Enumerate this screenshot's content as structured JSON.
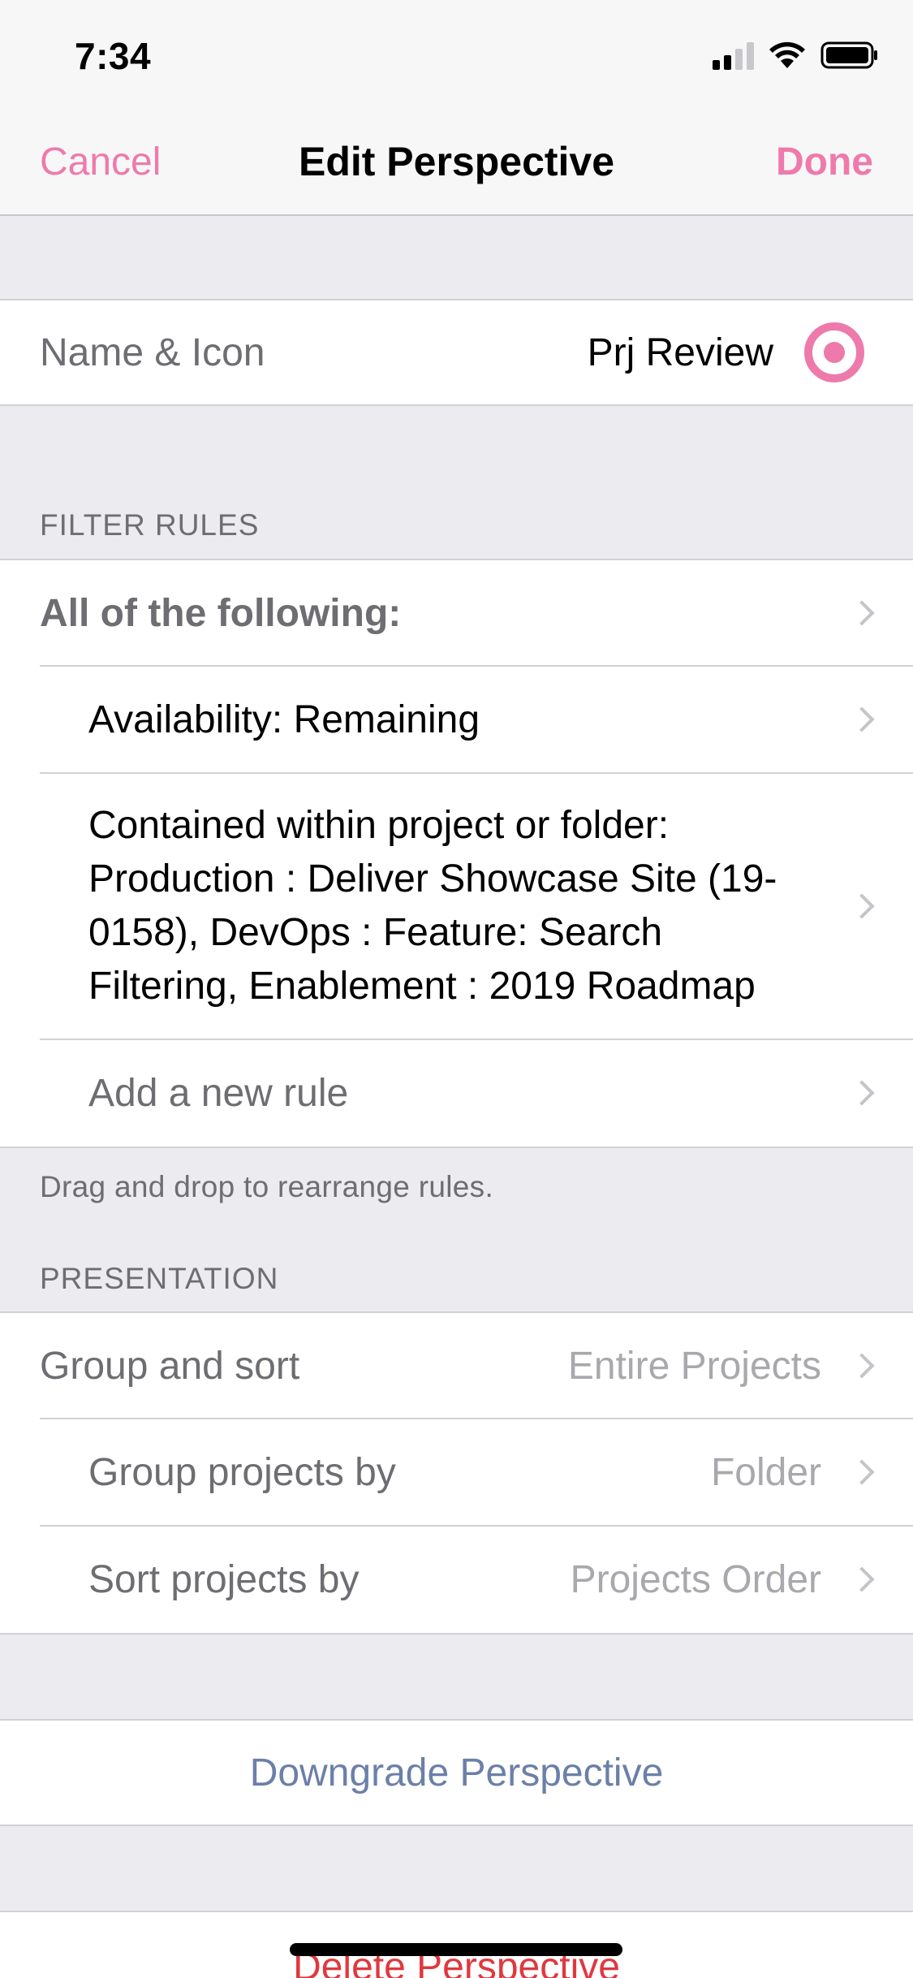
{
  "status_bar": {
    "time": "7:34"
  },
  "nav": {
    "cancel_label": "Cancel",
    "title": "Edit Perspective",
    "done_label": "Done"
  },
  "name_icon": {
    "label": "Name & Icon",
    "value": "Prj Review",
    "icon": "target-icon"
  },
  "filter_rules": {
    "header": "FILTER RULES",
    "group_label": "All of the following:",
    "rules": [
      "Availability: Remaining",
      "Contained within project or folder: Production : Deliver Showcase Site (19-0158), DevOps : Feature: Search Filtering, Enablement : 2019 Roadmap"
    ],
    "add_rule_label": "Add a new rule",
    "footer": "Drag and drop to rearrange rules."
  },
  "presentation": {
    "header": "PRESENTATION",
    "group_sort_label": "Group and sort",
    "group_sort_value": "Entire Projects",
    "group_by_label": "Group projects by",
    "group_by_value": "Folder",
    "sort_by_label": "Sort projects by",
    "sort_by_value": "Projects Order"
  },
  "actions": {
    "downgrade_label": "Downgrade Perspective",
    "delete_label": "Delete Perspective"
  },
  "colors": {
    "accent": "#ee7aab",
    "link_blue": "#6b7fa8",
    "destructive": "#e0383e",
    "background": "#ebebf0"
  }
}
